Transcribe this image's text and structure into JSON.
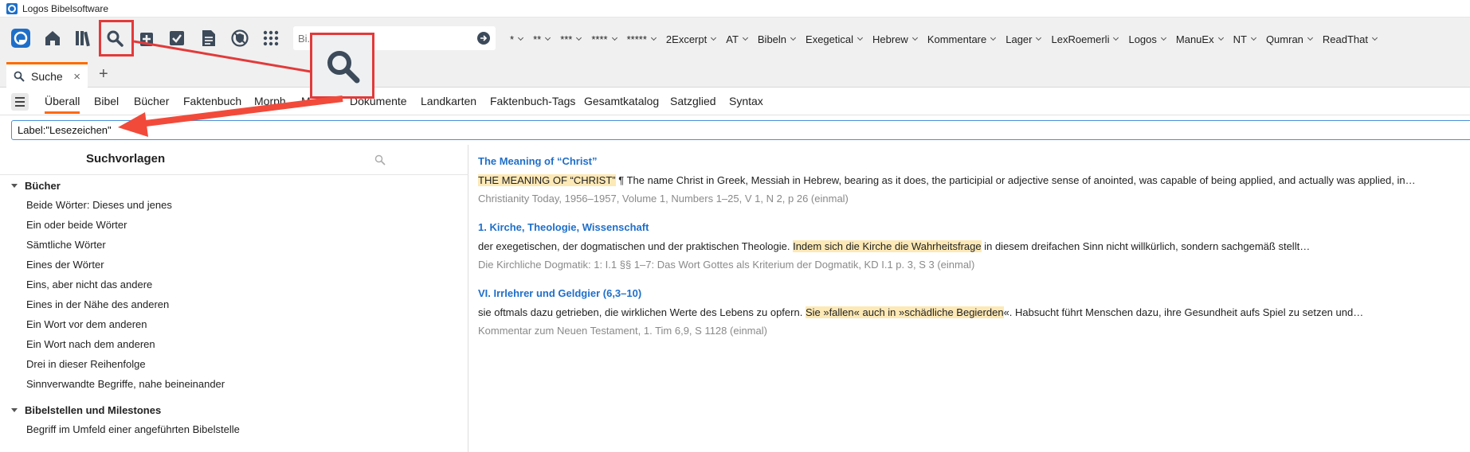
{
  "window": {
    "title": "Logos Bibelsoftware"
  },
  "toolbar": {
    "icons": [
      "logos-icon",
      "home-icon",
      "library-icon",
      "search-icon",
      "add-panel-icon",
      "checklist-icon",
      "document-icon",
      "shield-icon",
      "apps-grid-icon"
    ],
    "search_placeholder": "Bi... Thema",
    "layouts": [
      "*",
      "**",
      "***",
      "****",
      "*****",
      "2Excerpt",
      "AT",
      "Bibeln",
      "Exegetical",
      "Hebrew",
      "Kommentare",
      "Lager",
      "LexRoemerli",
      "Logos",
      "ManuEx",
      "NT",
      "Qumran",
      "ReadThat"
    ]
  },
  "tabs": {
    "active_label": "Suche",
    "close": "×",
    "add": "+"
  },
  "search_types": [
    "Überall",
    "Bibel",
    "Bücher",
    "Faktenbuch",
    "Morph",
    "M",
    "Dokumente",
    "Landkarten",
    "Faktenbuch-Tags",
    "Gesamtkatalog",
    "Satzglied",
    "Syntax"
  ],
  "query": {
    "value": "Label:\"Lesezeichen\""
  },
  "left_pane": {
    "title": "Suchvorlagen",
    "groups": [
      {
        "label": "Bücher",
        "items": [
          "Beide Wörter: Dieses und jenes",
          "Ein oder beide Wörter",
          "Sämtliche Wörter",
          "Eines der Wörter",
          "Eins, aber nicht das andere",
          "Eines in der Nähe des anderen",
          "Ein Wort vor dem anderen",
          "Ein Wort nach dem anderen",
          "Drei in dieser Reihenfolge",
          "Sinnverwandte Begriffe, nahe beineinander"
        ]
      },
      {
        "label": "Bibelstellen und Milestones",
        "items": [
          "Begriff im Umfeld einer angeführten Bibelstelle"
        ]
      }
    ]
  },
  "results": [
    {
      "title": "The Meaning of “Christ”",
      "pre": "",
      "highlight": "THE MEANING OF “CHRIST”",
      "post": " ¶ The name Christ in Greek, Messiah in Hebrew, bearing as it does, the participial or adjective sense of anointed, was capable of being applied, and actually was applied, in…",
      "source": "Christianity Today, 1956–1957, Volume 1, Numbers 1–25, V 1, N 2, p 26 (einmal)"
    },
    {
      "title": "1. Kirche, Theologie, Wissenschaft",
      "pre": "der exegetischen, der dogmatischen und der praktischen Theologie. ",
      "highlight": "Indem sich die Kirche die Wahrheitsfrage",
      "post": " in diesem dreifachen Sinn nicht willkürlich, sondern sachgemäß stellt…",
      "source": "Die Kirchliche Dogmatik: 1: I.1 §§ 1–7: Das Wort Gottes als Kriterium der Dogmatik, KD I.1 p. 3, S 3 (einmal)"
    },
    {
      "title": "VI. Irrlehrer und Geldgier (6,3–10)",
      "pre": "sie oftmals dazu getrieben, die wirklichen Werte des Lebens zu opfern. ",
      "highlight": "Sie »fallen« auch in »schädliche Begierden",
      "post": "«. Habsucht führt Menschen dazu, ihre Gesundheit aufs Spiel zu setzen und…",
      "source": "Kommentar zum Neuen Testament, 1. Tim 6,9, S 1128 (einmal)"
    }
  ],
  "colors": {
    "accent": "#ff6a00",
    "link": "#1f6fc9",
    "highlight": "#fde9b6",
    "annotation": "#e23a3a"
  }
}
